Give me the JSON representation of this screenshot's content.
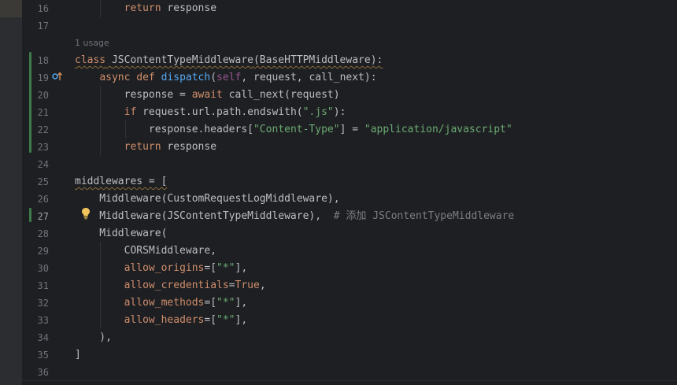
{
  "editor": {
    "usage_hint": "1 usage",
    "lines": [
      {
        "num": "16",
        "tokens": [
          {
            "t": "        "
          },
          {
            "t": "return",
            "c": "kw"
          },
          {
            "t": " response"
          }
        ]
      },
      {
        "num": "17",
        "tokens": []
      },
      {
        "num": "18",
        "tokens": [
          {
            "t": "class",
            "c": "kw squig"
          },
          {
            "t": " ",
            "c": "squig"
          },
          {
            "t": "JSContentTypeMiddleware",
            "c": "plain squig"
          },
          {
            "t": "(BaseHTTPMiddleware):",
            "c": "plain squig"
          }
        ]
      },
      {
        "num": "19",
        "tokens": [
          {
            "t": "    "
          },
          {
            "t": "async",
            "c": "kw"
          },
          {
            "t": " "
          },
          {
            "t": "def",
            "c": "kw"
          },
          {
            "t": " "
          },
          {
            "t": "dispatch",
            "c": "fn"
          },
          {
            "t": "("
          },
          {
            "t": "self",
            "c": "self"
          },
          {
            "t": ", request, call_next):"
          }
        ]
      },
      {
        "num": "20",
        "tokens": [
          {
            "t": "        response = "
          },
          {
            "t": "await",
            "c": "kw"
          },
          {
            "t": " call_next(request)"
          }
        ]
      },
      {
        "num": "21",
        "tokens": [
          {
            "t": "        "
          },
          {
            "t": "if",
            "c": "kw"
          },
          {
            "t": " request.url.path.endswith("
          },
          {
            "t": "\".js\"",
            "c": "str"
          },
          {
            "t": "):"
          }
        ]
      },
      {
        "num": "22",
        "tokens": [
          {
            "t": "            response.headers["
          },
          {
            "t": "\"Content-Type\"",
            "c": "str"
          },
          {
            "t": "] = "
          },
          {
            "t": "\"application/javascript\"",
            "c": "str"
          }
        ]
      },
      {
        "num": "23",
        "tokens": [
          {
            "t": "        "
          },
          {
            "t": "return",
            "c": "kw"
          },
          {
            "t": " response"
          }
        ]
      },
      {
        "num": "24",
        "tokens": []
      },
      {
        "num": "25",
        "tokens": [
          {
            "t": "middlewares = [",
            "c": "plain squig"
          }
        ]
      },
      {
        "num": "26",
        "tokens": [
          {
            "t": "    Middleware(CustomRequestLogMiddleware),"
          }
        ]
      },
      {
        "num": "27",
        "tokens": [
          {
            "t": "    Middleware(JSContentTypeMiddleware),  "
          },
          {
            "t": "# 添加 JSContentTypeMiddleware",
            "c": "cmt"
          }
        ]
      },
      {
        "num": "28",
        "tokens": [
          {
            "t": "    Middleware("
          }
        ]
      },
      {
        "num": "29",
        "tokens": [
          {
            "t": "        CORSMiddleware,"
          }
        ]
      },
      {
        "num": "30",
        "tokens": [
          {
            "t": "        "
          },
          {
            "t": "allow_origins",
            "c": "param"
          },
          {
            "t": "=["
          },
          {
            "t": "\"*\"",
            "c": "str"
          },
          {
            "t": "],"
          }
        ]
      },
      {
        "num": "31",
        "tokens": [
          {
            "t": "        "
          },
          {
            "t": "allow_credentials",
            "c": "param"
          },
          {
            "t": "="
          },
          {
            "t": "True",
            "c": "kw"
          },
          {
            "t": ","
          }
        ]
      },
      {
        "num": "32",
        "tokens": [
          {
            "t": "        "
          },
          {
            "t": "allow_methods",
            "c": "param"
          },
          {
            "t": "=["
          },
          {
            "t": "\"*\"",
            "c": "str"
          },
          {
            "t": "],"
          }
        ]
      },
      {
        "num": "33",
        "tokens": [
          {
            "t": "        "
          },
          {
            "t": "allow_headers",
            "c": "param"
          },
          {
            "t": "=["
          },
          {
            "t": "\"*\"",
            "c": "str"
          },
          {
            "t": "],"
          }
        ]
      },
      {
        "num": "34",
        "tokens": [
          {
            "t": "    ),"
          }
        ]
      },
      {
        "num": "35",
        "tokens": [
          {
            "t": "]"
          }
        ]
      },
      {
        "num": "36",
        "tokens": []
      }
    ],
    "active_line": "27",
    "icons": {
      "gutter_override": "override-method-icon",
      "intention": "lightbulb-icon"
    },
    "colors": {
      "background": "#1e1f22",
      "keyword": "#cf8e6d",
      "function": "#56a8f5",
      "string": "#6aab73",
      "self": "#94558d",
      "comment": "#7a7e85",
      "change_bar": "#3f7a4a",
      "bulb": "#f2c55c"
    }
  }
}
